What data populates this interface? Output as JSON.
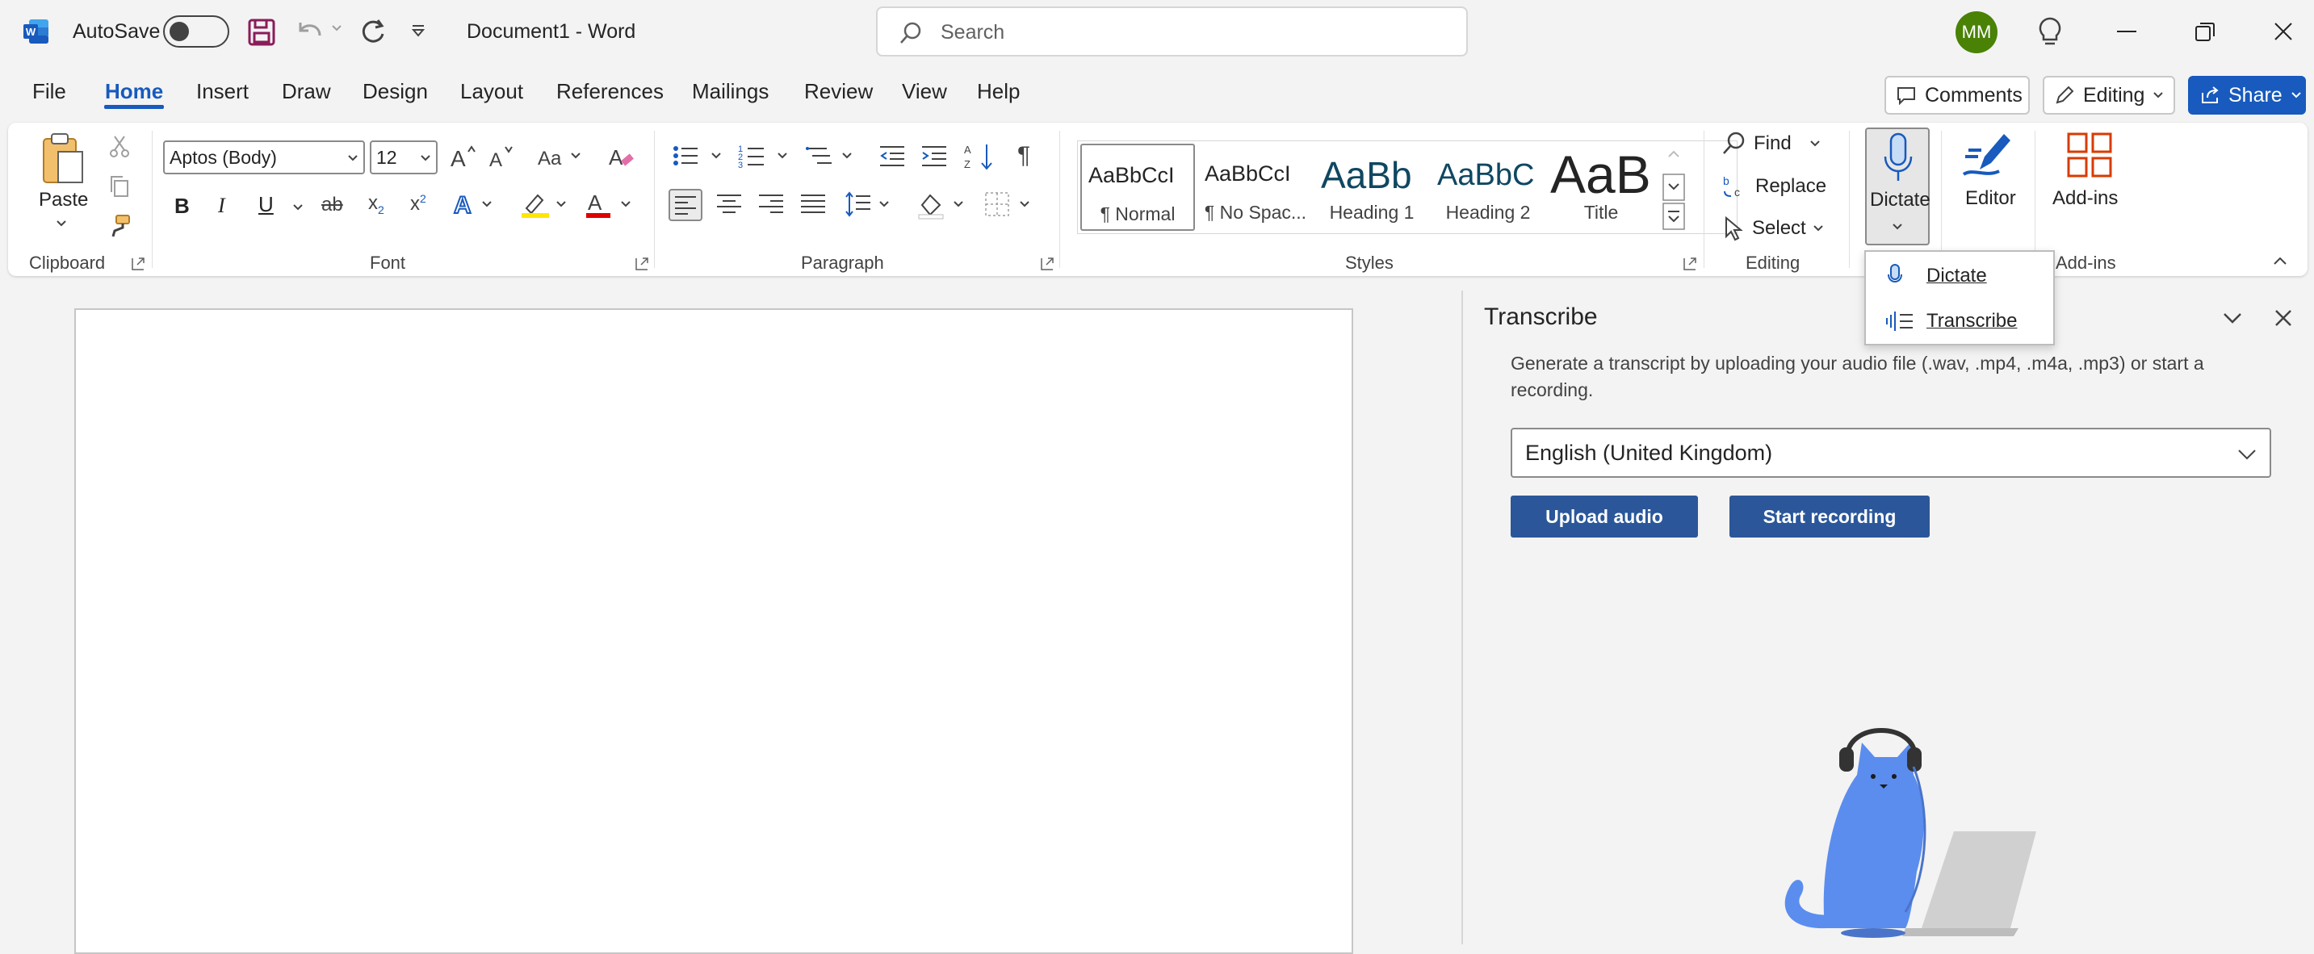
{
  "titlebar": {
    "autosave_label": "AutoSave",
    "document_title": "Document1  -  Word",
    "search_placeholder": "Search",
    "avatar_initials": "MM"
  },
  "menu": {
    "tabs": [
      "File",
      "Home",
      "Insert",
      "Draw",
      "Design",
      "Layout",
      "References",
      "Mailings",
      "Review",
      "View",
      "Help"
    ],
    "active_tab": "Home",
    "comments_label": "Comments",
    "editing_label": "Editing",
    "share_label": "Share"
  },
  "ribbon": {
    "clipboard": {
      "label": "Clipboard",
      "paste_label": "Paste"
    },
    "font": {
      "label": "Font",
      "font_name": "Aptos (Body)",
      "font_size": "12"
    },
    "paragraph": {
      "label": "Paragraph"
    },
    "styles": {
      "label": "Styles",
      "items": [
        {
          "preview": "AaBbCcI",
          "name": "¶ Normal"
        },
        {
          "preview": "AaBbCcI",
          "name": "¶ No Spac..."
        },
        {
          "preview": "AaBb",
          "name": "Heading 1"
        },
        {
          "preview": "AaBbC",
          "name": "Heading 2"
        },
        {
          "preview": "AaB",
          "name": "Title"
        }
      ]
    },
    "editing": {
      "label": "Editing",
      "find_label": "Find",
      "replace_label": "Replace",
      "select_label": "Select"
    },
    "dictate_label": "Dictate",
    "editor_label": "Editor",
    "addins_label": "Add-ins",
    "addins_group_label": "Add-ins"
  },
  "dictate_menu": {
    "items": [
      "Dictate",
      "Transcribe"
    ]
  },
  "transcribe_pane": {
    "title": "Transcribe",
    "description_line1": "Generate a transcript by uploading your audio file (.wav, .mp4, .m4a, .mp3) or start a",
    "description_line2": "recording.",
    "language": "English (United Kingdom)",
    "upload_label": "Upload audio",
    "record_label": "Start recording"
  },
  "colors": {
    "accent": "#185abd",
    "button_blue": "#2b579a",
    "word_blue": "#2b579a",
    "avatar_green": "#498205",
    "addins_red": "#d83b01"
  },
  "icons": [
    "word-logo-icon",
    "save-icon",
    "undo-icon",
    "redo-icon",
    "customize-icon",
    "search-icon",
    "lightbulb-icon",
    "minimize-icon",
    "restore-icon",
    "close-icon",
    "comment-icon",
    "pencil-icon",
    "share-icon",
    "microphone-icon",
    "editor-icon",
    "addins-icon"
  ]
}
